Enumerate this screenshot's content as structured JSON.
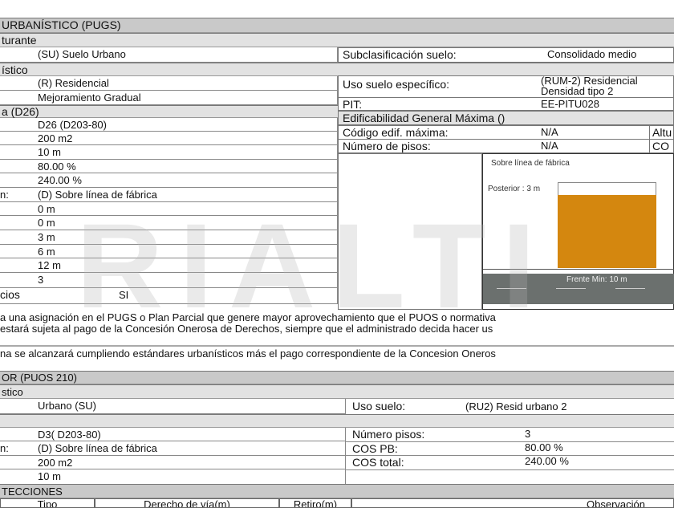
{
  "pugs": {
    "title": "URBANÍSTICO (PUGS)",
    "sec1": "turante",
    "suelo": "(SU) Suelo Urbano",
    "subclas_label": "Subclasificación suelo:",
    "subclas_value": "Consolidado medio",
    "sec2": "ístico",
    "uso_general": "(R) Residencial",
    "tratamiento": "Mejoramiento Gradual",
    "uso_esp_label": "Uso suelo específico:",
    "uso_esp_value1": "(RUM-2) Residencial",
    "uso_esp_value2": "Densidad tipo 2",
    "pit_label": "PIT:",
    "pit_value": "EE-PITU028",
    "sec3": "a (D26)",
    "edif_title": "Edificabilidad General Máxima ()",
    "codigo_label": "Código edif. máxima:",
    "codigo_value": "N/A",
    "altura_label": "Altu",
    "pisos_label": "Número de pisos:",
    "pisos_value": "N/A",
    "cos_label": "CO",
    "rows": [
      {
        "label": "",
        "value": "D26 (D203-80)"
      },
      {
        "label": "",
        "value": "200 m2"
      },
      {
        "label": "",
        "value": "10 m"
      },
      {
        "label": "",
        "value": "80.00 %"
      },
      {
        "label": "",
        "value": "240.00 %"
      },
      {
        "label": "n:",
        "value": "(D) Sobre línea de fábrica"
      },
      {
        "label": "",
        "value": "0 m"
      },
      {
        "label": "",
        "value": "0 m"
      },
      {
        "label": "",
        "value": "3 m"
      },
      {
        "label": "",
        "value": "6 m"
      },
      {
        "label": "",
        "value": "12 m"
      },
      {
        "label": "",
        "value": "3"
      }
    ],
    "servicios_label": "cios",
    "servicios_value": "SI",
    "diagram": {
      "title": "Sobre línea de fábrica",
      "posterior": "Posterior : 3 m",
      "frente": "Frente Min: 10 m",
      "fill_color": "#d4870f"
    }
  },
  "notes": {
    "line1": "a una asignación en el PUGS o Plan Parcial que genere mayor aprovechamiento que el PUOS o normativa",
    "line2": "estará sujeta al pago de la Concesión Onerosa de Derechos, siempre que el administrado decida hacer us",
    "line3": "na se alcanzará cumpliendo estándares urbanísticos más el pago correspondiente de la Concesion Oneros"
  },
  "puos": {
    "title": "OR (PUOS 210)",
    "sec1": "stico",
    "clasif": "Urbano (SU)",
    "uso_label": "Uso suelo:",
    "uso_value": "(RU2) Resid urbano 2",
    "zona": "D3( D203-80)",
    "forma_label": "n:",
    "forma": "(D) Sobre línea de fábrica",
    "lote": "200 m2",
    "frente": "10 m",
    "pisos_label": "Número pisos:",
    "pisos_value": "3",
    "cospb_label": "COS PB:",
    "cospb_value": "80.00 %",
    "cost_label": "COS total:",
    "cost_value": "240.00 %"
  },
  "afect": {
    "title": "TECCIONES",
    "headers": [
      "Tipo",
      "Derecho de vía(m)",
      "Retiro(m)",
      "Observación"
    ]
  },
  "watermark": "RIALTI"
}
